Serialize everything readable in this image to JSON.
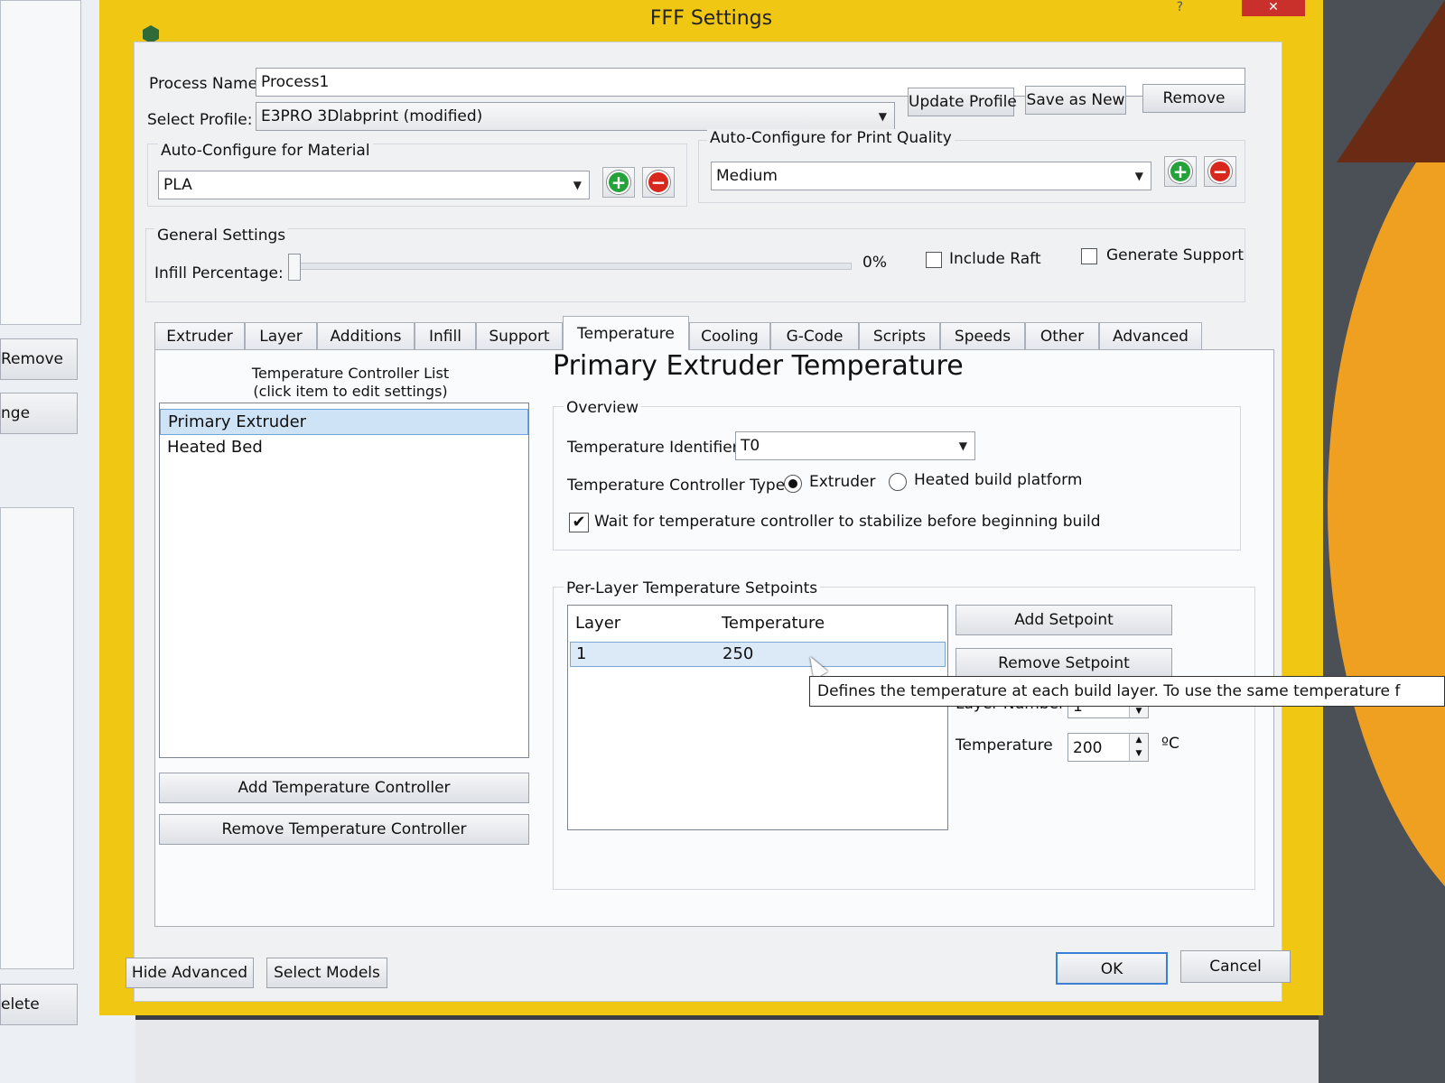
{
  "background": {
    "buttons": [
      "Remove",
      "nge",
      "elete"
    ]
  },
  "window": {
    "title": "FFF Settings",
    "close_glyph": "✕",
    "help_glyph": "?"
  },
  "process": {
    "name_label": "Process Name:",
    "name_value": "Process1",
    "profile_label": "Select Profile:",
    "profile_value": "E3PRO 3Dlabprint (modified)",
    "update_button": "Update Profile",
    "save_new_button": "Save as New",
    "remove_button": "Remove"
  },
  "material": {
    "label": "Auto-Configure for Material",
    "value": "PLA"
  },
  "quality": {
    "label": "Auto-Configure for Print Quality",
    "value": "Medium"
  },
  "general": {
    "label": "General Settings",
    "infill_label": "Infill Percentage:",
    "infill_value": "0%",
    "infill_fraction": 0,
    "raft_label": "Include Raft",
    "raft_checked": false,
    "support_label": "Generate Support",
    "support_checked": false
  },
  "tabs": [
    "Extruder",
    "Layer",
    "Additions",
    "Infill",
    "Support",
    "Temperature",
    "Cooling",
    "G-Code",
    "Scripts",
    "Speeds",
    "Other",
    "Advanced"
  ],
  "active_tab": "Temperature",
  "controllers": {
    "header_line1": "Temperature Controller List",
    "header_line2": "(click item to edit settings)",
    "items": [
      "Primary Extruder",
      "Heated Bed"
    ],
    "add_button": "Add Temperature Controller",
    "remove_button": "Remove Temperature Controller"
  },
  "detail": {
    "heading": "Primary Extruder Temperature",
    "overview_label": "Overview",
    "identifier_label": "Temperature Identifier",
    "identifier_value": "T0",
    "type_label": "Temperature Controller Type:",
    "type_extruder": "Extruder",
    "type_bed": "Heated build platform",
    "type_selected": "Extruder",
    "wait_label": "Wait for temperature controller to stabilize before beginning build",
    "wait_checked": true,
    "setpoints_label": "Per-Layer Temperature Setpoints",
    "col_layer": "Layer",
    "col_temp": "Temperature",
    "rows": [
      {
        "layer": "1",
        "temp": "250"
      }
    ],
    "add_setpoint": "Add Setpoint",
    "remove_setpoint": "Remove Setpoint",
    "layer_number_label": "Layer Number",
    "layer_number_value": "1",
    "temperature_label": "Temperature",
    "temperature_value": "200",
    "temperature_unit": "ºC",
    "tooltip": "Defines the temperature at each build layer.  To use the same temperature f"
  },
  "footer": {
    "hide_advanced": "Hide Advanced",
    "select_models": "Select Models",
    "ok": "OK",
    "cancel": "Cancel"
  }
}
